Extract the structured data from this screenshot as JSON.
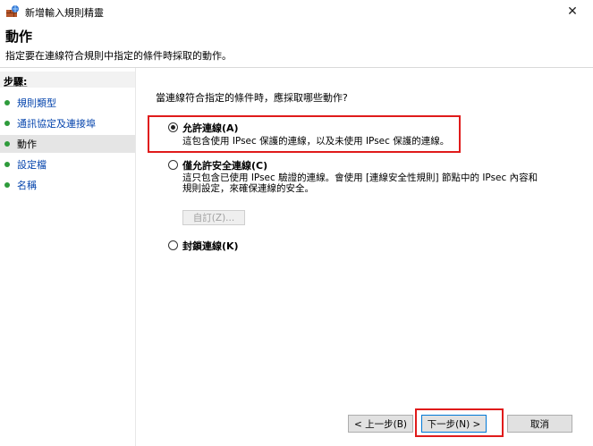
{
  "window": {
    "title": "新增輸入規則精靈",
    "close_glyph": "✕"
  },
  "header": {
    "title": "動作",
    "subtitle": "指定要在連線符合規則中指定的條件時採取的動作。"
  },
  "sidebar": {
    "heading": "步驟:",
    "steps": [
      {
        "label": "規則類型",
        "current": false
      },
      {
        "label": "通訊協定及連接埠",
        "current": false
      },
      {
        "label": "動作",
        "current": true
      },
      {
        "label": "設定檔",
        "current": false
      },
      {
        "label": "名稱",
        "current": false
      }
    ]
  },
  "main": {
    "question": "當連線符合指定的條件時，應採取哪些動作?",
    "options": [
      {
        "label": "允許連線(A)",
        "description": [
          "這包含使用 IPsec 保護的連線，以及未使用 IPsec 保護的連線。"
        ],
        "selected": true
      },
      {
        "label": "僅允許安全連線(C)",
        "description": [
          "這只包含已使用 IPsec 驗證的連線。會使用 [連線安全性規則] 節點中的 IPsec 內容和",
          "規則設定，來確保連線的安全。"
        ],
        "selected": false
      },
      {
        "label": "封鎖連線(K)",
        "description": [],
        "selected": false
      }
    ],
    "custom_button": "自訂(Z)..."
  },
  "footer": {
    "back": "< 上一步(B)",
    "next": "下一步(N) >",
    "cancel": "取消"
  },
  "colors": {
    "highlight": "#e01b1b",
    "step_dot": "#2e9b3b",
    "link": "#0645ad"
  },
  "icons": {
    "app": "firewall-icon",
    "close": "close-icon"
  }
}
